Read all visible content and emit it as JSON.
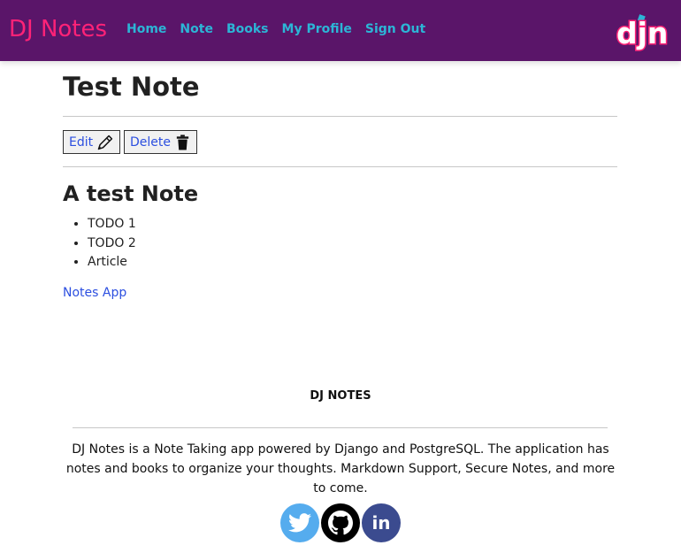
{
  "nav": {
    "brand": "DJ Notes",
    "links": [
      "Home",
      "Note",
      "Books",
      "My Profile",
      "Sign Out"
    ],
    "logo_text": "djn",
    "colors": {
      "bar": "#5a1569",
      "brand": "#ff2277",
      "link": "#2cb5d6"
    }
  },
  "note": {
    "title": "Test Note",
    "edit_label": "Edit",
    "delete_label": "Delete",
    "heading": "A test Note",
    "items": [
      "TODO 1",
      "TODO 2",
      "Article"
    ],
    "app_link": "Notes App"
  },
  "footer": {
    "title": "DJ NOTES",
    "description": "DJ Notes is a Note Taking app powered by Django and PostgreSQL. The application has notes and books to organize your thoughts. Markdown Support, Secure Notes, and more to come.",
    "social": [
      {
        "name": "twitter-icon",
        "color": "#55acee"
      },
      {
        "name": "github-icon",
        "color": "#000000"
      },
      {
        "name": "linkedin-icon",
        "color": "#3b4b8f",
        "text": "in"
      }
    ]
  }
}
